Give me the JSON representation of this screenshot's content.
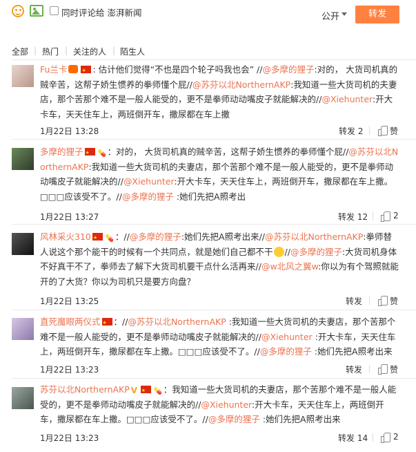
{
  "composer": {
    "sync_label": "同时评论给 澎湃新闻",
    "visibility": "公开",
    "repost_button": "转发"
  },
  "filters": {
    "items": [
      "全部",
      "热门",
      "关注的人",
      "陌生人"
    ],
    "separator": "|"
  },
  "comments": [
    {
      "user": "Fu兰卡",
      "parts": [
        {
          "t": ": 估计他们觉得“不也是四个轮子吗我也会” //",
          "m": false
        },
        {
          "t": "@多摩的狸子",
          "m": true
        },
        {
          "t": ":对的， 大货司机真的贼辛苦，这帮子娇生惯养的拳师懂个屁//",
          "m": false
        },
        {
          "t": "@苏芬以北NorthernAKP",
          "m": true
        },
        {
          "t": ":我知道一些大货司机的夫妻店，那个苦那个难不是一般人能受的，更不是拳师动动嘴皮子就能解决的//",
          "m": false
        },
        {
          "t": "@Xiehunter",
          "m": true
        },
        {
          "t": ":开大卡车，天天住车上，两班倒开车，撒尿都在车上撒",
          "m": false
        }
      ],
      "time": "1月22日 13:28",
      "repost": "转发 2",
      "like": "赞"
    },
    {
      "user": "多摩的狸子",
      "parts": [
        {
          "t": "：对的， 大货司机真的贼辛苦，这帮子娇生惯养的拳师懂个屁//",
          "m": false
        },
        {
          "t": "@苏芬以北NorthernAKP",
          "m": true
        },
        {
          "t": ":我知道一些大货司机的夫妻店，那个苦那个难不是一般人能受的，更不是拳师动动嘴皮子就能解决的//",
          "m": false
        },
        {
          "t": "@Xiehunter",
          "m": true
        },
        {
          "t": ":开大卡车，天天住车上，两班倒开车，撒尿都在车上撒。□□□应该受不了。//",
          "m": false
        },
        {
          "t": "@多摩的狸子",
          "m": true
        },
        {
          "t": " :她们先把A照考出",
          "m": false
        }
      ],
      "time": "1月22日 13:27",
      "repost": "转发 12",
      "like": "2"
    },
    {
      "user": "风林采火310",
      "parts": [
        {
          "t": "：//",
          "m": false
        },
        {
          "t": "@多摩的狸子",
          "m": true
        },
        {
          "t": ":她们先把A照考出来//",
          "m": false
        },
        {
          "t": "@苏芬以北NorthernAKP",
          "m": true
        },
        {
          "t": ":拳师替人说这个那个能干的时候有一个共同点，就是她们自己都不干",
          "m": false
        },
        {
          "t": "//",
          "m": false
        },
        {
          "t": "@多摩的狸子",
          "m": true
        },
        {
          "t": ":大货司机身体不好真干不了，拳师去了解下大货司机要干点什么活再来//",
          "m": false
        },
        {
          "t": "@w北风之翼w",
          "m": true
        },
        {
          "t": ":你以为有个驾照就能开的了大货？你以为司机只是要方向盘？",
          "m": false
        }
      ],
      "time": "1月22日 13:25",
      "repost": "转发",
      "like": "赞"
    },
    {
      "user": "直死魔眼两仪式",
      "parts": [
        {
          "t": "：//",
          "m": false
        },
        {
          "t": "@苏芬以北NorthernAKP",
          "m": true
        },
        {
          "t": " :我知道一些大货司机的夫妻店，那个苦那个难不是一般人能受的，更不是拳师动动嘴皮子就能解决的//",
          "m": false
        },
        {
          "t": "@Xiehunter",
          "m": true
        },
        {
          "t": " :开大卡车，天天住车上，两班倒开车，撒尿都在车上撒。□□□应该受不了。//",
          "m": false
        },
        {
          "t": "@多摩的狸子",
          "m": true
        },
        {
          "t": " :她们先把A照考出来",
          "m": false
        }
      ],
      "time": "1月22日 13:23",
      "repost": "转发",
      "like": "赞"
    },
    {
      "user": "苏芬以北NorthernAKP",
      "parts": [
        {
          "t": "：我知道一些大货司机的夫妻店，那个苦那个难不是一般人能受的，更不是拳师动动嘴皮子就能解决的//",
          "m": false
        },
        {
          "t": "@Xiehunter",
          "m": true
        },
        {
          "t": ":开大卡车，天天住车上，两班倒开车，撒尿都在车上撒。□□□应该受不了。//",
          "m": false
        },
        {
          "t": "@多摩的狸子",
          "m": true
        },
        {
          "t": " :她们先把A照考出来",
          "m": false
        }
      ],
      "time": "1月22日 13:23",
      "repost": "转发 14",
      "like": "2"
    }
  ],
  "colors": {
    "accent": "#ff8140",
    "mention": "#eb7350"
  }
}
